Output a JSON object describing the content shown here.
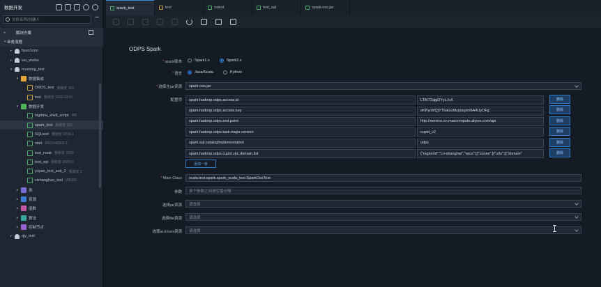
{
  "sidebar": {
    "title": "数据开发",
    "search_placeholder": "文件名称/创建人",
    "tree": [
      {
        "label": "解决方案",
        "type": "section",
        "indent": 0,
        "icon": "grid",
        "expanded": false
      },
      {
        "label": "业务流程",
        "type": "section",
        "indent": 0,
        "icon": "none",
        "expanded": true
      },
      {
        "label": "fiyun1ooo",
        "type": "flow",
        "indent": 1,
        "icon": "person",
        "expanded": false
      },
      {
        "label": "ian_works",
        "type": "flow",
        "indent": 1,
        "icon": "person",
        "expanded": false
      },
      {
        "label": "muxiong_test",
        "type": "flow",
        "indent": 1,
        "icon": "person",
        "expanded": true
      },
      {
        "label": "数据集成",
        "type": "folder",
        "indent": 2,
        "icon": "folder",
        "expanded": true
      },
      {
        "label": "DRDS_test",
        "meta": "我锁定 201",
        "type": "node",
        "indent": 3,
        "icon": "file"
      },
      {
        "label": "test",
        "meta": "我锁定 2020-02-07",
        "type": "node",
        "indent": 3,
        "icon": "file"
      },
      {
        "label": "数据开发",
        "type": "folder",
        "indent": 2,
        "icon": "dev",
        "expanded": true
      },
      {
        "label": "bigdata_shell_script",
        "meta": "W8",
        "type": "node",
        "indent": 3,
        "icon": "sql"
      },
      {
        "label": "spark_test",
        "meta": "我锁定 201",
        "type": "node",
        "indent": 3,
        "icon": "sql",
        "selected": true
      },
      {
        "label": "SQLtest",
        "meta": "我锁定 2019-1",
        "type": "node",
        "indent": 3,
        "icon": "sql"
      },
      {
        "label": "start",
        "meta": "5021642900 2",
        "type": "node",
        "indent": 3,
        "icon": "sql"
      },
      {
        "label": "test_node",
        "meta": "我锁定 2019",
        "type": "node",
        "indent": 3,
        "icon": "sql"
      },
      {
        "label": "test_sql",
        "meta": "我锁定 2020-0",
        "type": "node",
        "indent": 3,
        "icon": "sql"
      },
      {
        "label": "yuyao_test_sub_2",
        "meta": "我锁定 2",
        "type": "node",
        "indent": 3,
        "icon": "sql"
      },
      {
        "label": "zizhanghao_test",
        "meta": "W8150",
        "type": "node",
        "indent": 3,
        "icon": "sql"
      },
      {
        "label": "表",
        "type": "folder",
        "indent": 2,
        "icon": "purple",
        "expanded": false
      },
      {
        "label": "资源",
        "type": "folder",
        "indent": 2,
        "icon": "blue",
        "expanded": false
      },
      {
        "label": "函数",
        "type": "folder",
        "indent": 2,
        "icon": "pink",
        "expanded": false
      },
      {
        "label": "算法",
        "type": "folder",
        "indent": 2,
        "icon": "teal",
        "expanded": false
      },
      {
        "label": "控制节点",
        "type": "folder",
        "indent": 2,
        "icon": "violet",
        "expanded": false
      },
      {
        "label": "qjy_test",
        "type": "flow",
        "indent": 1,
        "icon": "person",
        "expanded": false
      }
    ]
  },
  "tabs": [
    {
      "label": "spark_test",
      "active": true,
      "color": "#4fae67"
    },
    {
      "label": "test",
      "active": false,
      "color": "#c9a43d"
    },
    {
      "label": "zstest",
      "active": false,
      "color": "#4fae67"
    },
    {
      "label": "test_sql",
      "active": false,
      "color": "#4fae67"
    },
    {
      "label": "spark-oss.jar",
      "active": false,
      "color": "#4fae67"
    }
  ],
  "form": {
    "heading": "ODPS Spark",
    "spark_version_label": "spark版本",
    "spark_versions": [
      "Spark1.x",
      "Spark2.x"
    ],
    "spark_version_selected": 1,
    "language_label": "语言",
    "languages": [
      "Java/Scala",
      "Python"
    ],
    "language_selected": 0,
    "main_jar_label": "选择主jar资源",
    "main_jar_value": "spark-oss.jar",
    "config_label": "配置项",
    "config": [
      {
        "key": "spark.hadoop.odps.access.id",
        "value": "LTAI72ajgDYyLJvX"
      },
      {
        "key": "spark.hadoop.odps.access.key",
        "value": "oKPycMQjYT6aGuMzpsuyen6A4UyOFg"
      },
      {
        "key": "spark.hadoop.odps.end.point",
        "value": "http://service.cn.maxcompute.aliyun.com/api"
      },
      {
        "key": "spark.hadoop.odps.task.major.version",
        "value": "cupid_v2"
      },
      {
        "key": "spark.sql.catalogImplementation",
        "value": "odps"
      },
      {
        "key": "spark.hadoop.odps.cupid.vpc.domain.list",
        "value": "{\"regionId\":\"cn-shanghai\",\"vpcs\":[{\"zones\":[{\"urls\":[{\"domain\""
      }
    ],
    "delete_label": "删除",
    "add_label": "添加一条",
    "main_class_label": "Main Class",
    "main_class_value": "scala.test.spark.spark_scala_test.SparkOssTest",
    "args_label": "参数",
    "args_placeholder": "多个参数之间请空格分隔",
    "jar_res_label": "选择jar资源",
    "file_res_label": "选择file资源",
    "archives_res_label": "选择archives资源",
    "select_placeholder": "请选择"
  },
  "colors": {
    "accent": "#2f87e0",
    "background": "#151b24",
    "sidebar": "#1f2632"
  }
}
